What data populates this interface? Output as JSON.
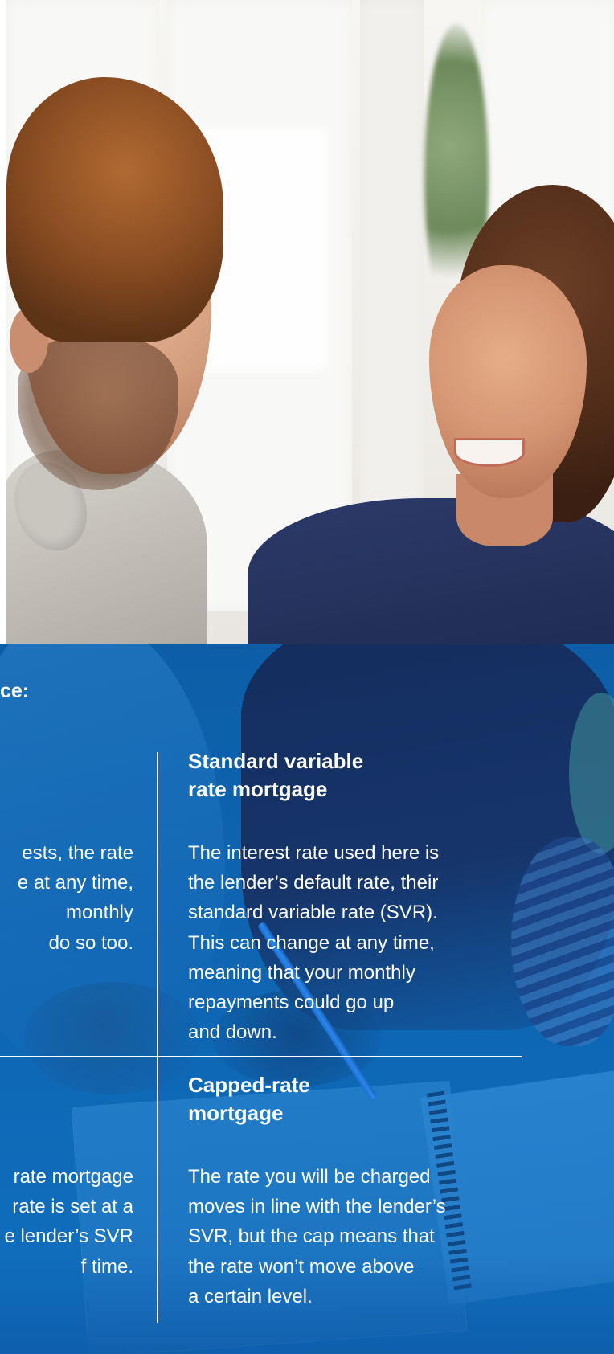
{
  "photo": {
    "description_icon": "photo-couple-icon"
  },
  "colors": {
    "panel_blue": "#0e67b5",
    "text": "#ffffff",
    "line": "#ffffff"
  },
  "section_title_fragment": "ce:",
  "left_column": {
    "top_body_lines": [
      "ests, the rate",
      "e at any time,",
      "monthly",
      "do so too."
    ],
    "bottom_body_lines": [
      "rate mortgage",
      "rate is set at a",
      "e lender’s SVR",
      "f time."
    ]
  },
  "standard_variable": {
    "heading_lines": [
      "Standard variable",
      "rate mortgage"
    ],
    "body_lines": [
      "The interest rate used here is",
      "the lender’s default rate, their",
      "standard variable rate (SVR).",
      "This can change at any time,",
      "meaning that your monthly",
      "repayments could go up",
      "and down."
    ]
  },
  "capped_rate": {
    "heading_lines": [
      "Capped-rate",
      "mortgage"
    ],
    "body_lines": [
      "The rate you will be charged",
      "moves in line with the lender’s",
      "SVR, but the cap means that",
      "the rate won’t move above",
      "a certain level."
    ]
  }
}
